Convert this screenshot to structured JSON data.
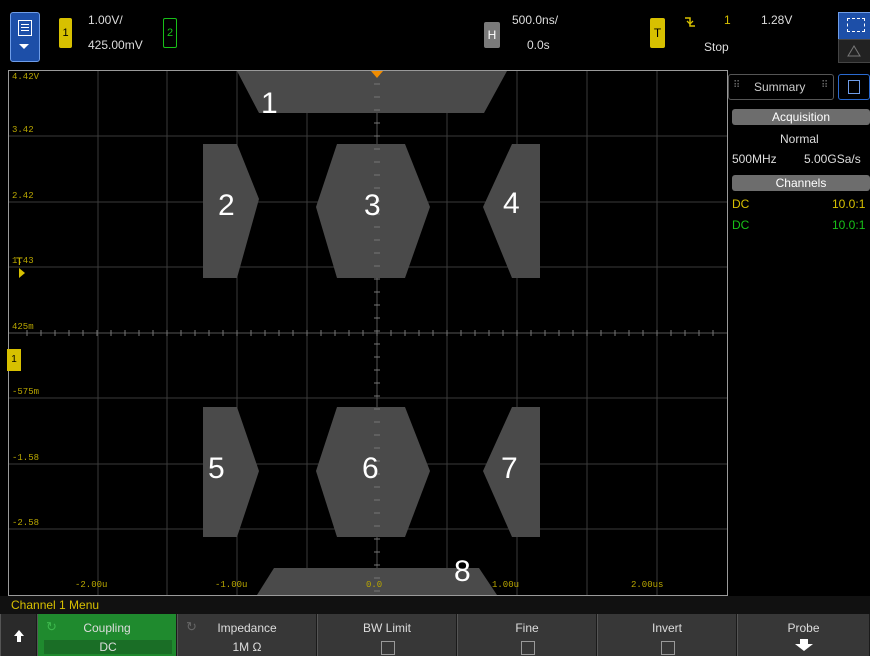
{
  "top": {
    "ch1_badge": "1",
    "ch1_scale": "1.00V/",
    "ch1_offset": "425.00mV",
    "ch2_badge": "2",
    "h_badge": "H",
    "time_scale": "500.0ns/",
    "time_delay": "0.0s",
    "t_badge": "T",
    "trig_source": "1",
    "trig_level": "1.28V",
    "run_state": "Stop"
  },
  "graticule": {
    "y_labels": [
      "4.42V",
      "3.42",
      "2.42",
      "1.43",
      "425m",
      "-575m",
      "-1.58",
      "-2.58"
    ],
    "x_labels": [
      "-2.00u",
      "-1.00u",
      "0.0",
      "1.00u",
      "2.00us"
    ],
    "trigger_marker": "T",
    "ground_marker": "1"
  },
  "shapes": {
    "labels": [
      "1",
      "2",
      "3",
      "4",
      "5",
      "6",
      "7",
      "8"
    ]
  },
  "right_panel": {
    "tab_summary": "Summary",
    "acq_header": "Acquisition",
    "acq_mode": "Normal",
    "acq_bw": "500MHz",
    "acq_rate": "5.00GSa/s",
    "channels_header": "Channels",
    "ch1_coupling": "DC",
    "ch1_probe": "10.0:1",
    "ch2_coupling": "DC",
    "ch2_probe": "10.0:1"
  },
  "bottom": {
    "menu_title": "Channel 1 Menu",
    "softkeys": [
      {
        "label": "Coupling",
        "value": "DC"
      },
      {
        "label": "Impedance",
        "value": "1M Ω"
      },
      {
        "label": "BW Limit"
      },
      {
        "label": "Fine"
      },
      {
        "label": "Invert"
      },
      {
        "label": "Probe"
      }
    ]
  },
  "colors": {
    "ch1": "#d7c000",
    "ch2": "#18c018",
    "accent": "#1d4fa8",
    "shape_fill": "#4a4a4a"
  }
}
